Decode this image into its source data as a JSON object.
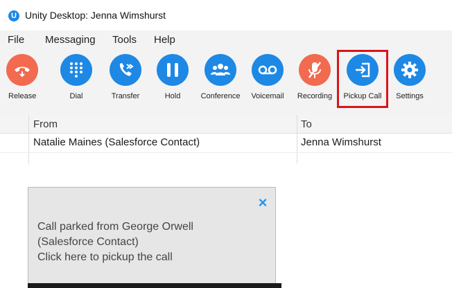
{
  "window": {
    "app_logo_letter": "U",
    "title": "Unity Desktop: Jenna Wimshurst"
  },
  "menu": [
    "File",
    "Messaging",
    "Tools",
    "Help"
  ],
  "toolbar": {
    "release": {
      "label": "Release",
      "icon": "release-icon",
      "color": "#F26A4F"
    },
    "dial": {
      "label": "Dial",
      "icon": "dialpad-icon",
      "color": "#1E88E5"
    },
    "transfer": {
      "label": "Transfer",
      "icon": "transfer-icon",
      "color": "#1E88E5"
    },
    "hold": {
      "label": "Hold",
      "icon": "pause-icon",
      "color": "#1E88E5"
    },
    "conference": {
      "label": "Conference",
      "icon": "group-icon",
      "color": "#1E88E5"
    },
    "voicemail": {
      "label": "Voicemail",
      "icon": "voicemail-icon",
      "color": "#1E88E5"
    },
    "recording": {
      "label": "Recording",
      "icon": "mic-off-icon",
      "color": "#F26A4F"
    },
    "pickup_call": {
      "label": "Pickup Call",
      "icon": "pickup-icon",
      "color": "#1E88E5"
    },
    "settings": {
      "label": "Settings",
      "icon": "gear-icon",
      "color": "#1E88E5"
    },
    "highlight_color": "#d8141b"
  },
  "calls_table": {
    "columns": [
      "From",
      "To"
    ],
    "rows": [
      {
        "from": "Natalie Maines (Salesforce Contact)",
        "to": "Jenna Wimshurst"
      }
    ]
  },
  "notification": {
    "close_glyph": "×",
    "lines": [
      "Call parked from George Orwell",
      "(Salesforce Contact)",
      "Click here to pickup the call"
    ]
  }
}
